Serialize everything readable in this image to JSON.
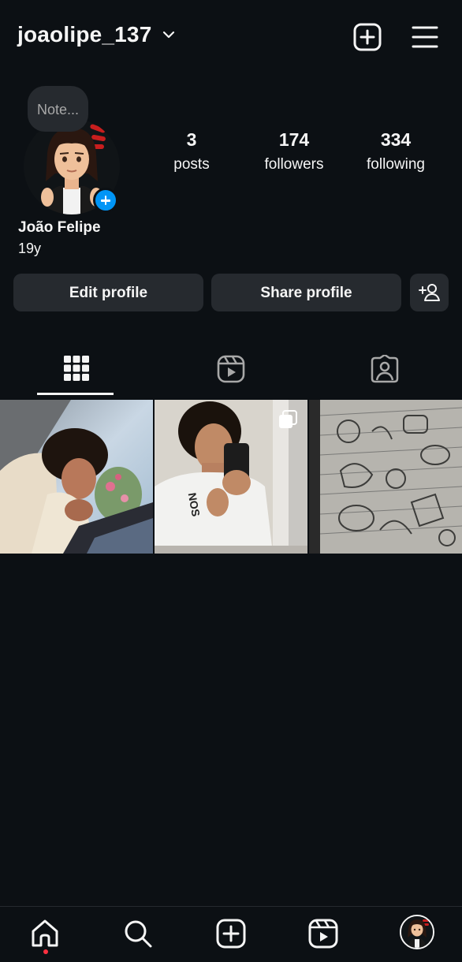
{
  "header": {
    "username": "joaolipe_137",
    "icons": [
      "chevron-down-icon",
      "add-post-icon",
      "menu-icon"
    ]
  },
  "profile": {
    "note_placeholder": "Note...",
    "full_name": "João Felipe",
    "bio": "19y",
    "stats": [
      {
        "value": "3",
        "label": "posts"
      },
      {
        "value": "174",
        "label": "followers"
      },
      {
        "value": "334",
        "label": "following"
      }
    ]
  },
  "actions": {
    "edit_label": "Edit profile",
    "share_label": "Share profile",
    "discover_icon": "add-person-icon"
  },
  "tabs": [
    {
      "name": "posts-grid",
      "icon": "grid-icon",
      "active": true
    },
    {
      "name": "reels",
      "icon": "reels-icon",
      "active": false
    },
    {
      "name": "tagged",
      "icon": "tagged-icon",
      "active": false
    }
  ],
  "posts": [
    {
      "kind": "photo",
      "multi": false
    },
    {
      "kind": "photo",
      "multi": true
    },
    {
      "kind": "photo",
      "multi": false
    }
  ],
  "bottom_nav": {
    "items": [
      "home-icon",
      "search-icon",
      "create-icon",
      "reels-icon",
      "profile-avatar"
    ],
    "notification_dot_color": "#ff3040"
  },
  "colors": {
    "background": "#0c1014",
    "surface": "#262a2f",
    "accent": "#0095f6",
    "text": "#f5f5f5"
  }
}
